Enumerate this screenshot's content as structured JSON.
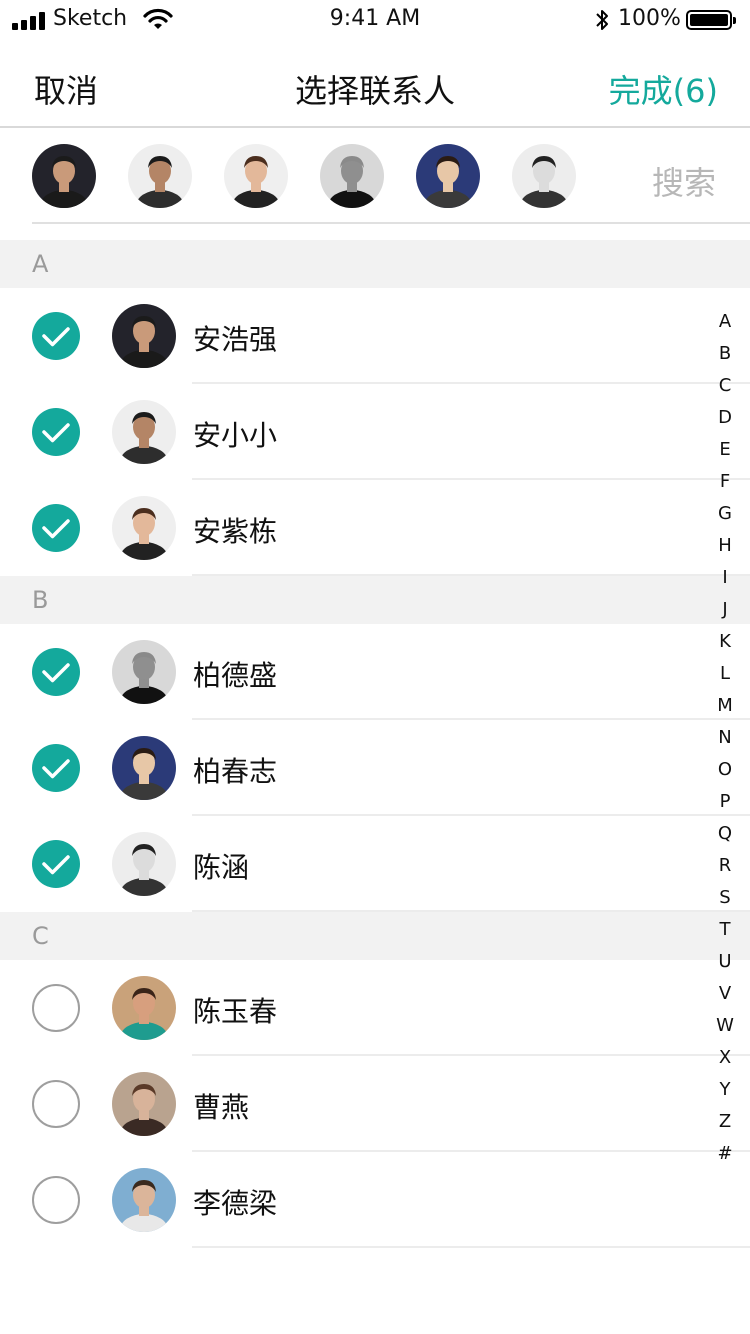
{
  "status_bar": {
    "carrier": "Sketch",
    "time": "9:41 AM",
    "battery": "100%"
  },
  "nav": {
    "cancel": "取消",
    "title": "选择联系人",
    "done": "完成(6)",
    "accent_color": "#14a99c"
  },
  "selected": {
    "avatars": [
      {
        "name": "安浩强",
        "icon": "avatar-man-beard",
        "bg": "#23232b",
        "skin": "#c99a7a",
        "hair": "#1b1b1b",
        "shirt": "#1a1a1a"
      },
      {
        "name": "安小小",
        "icon": "avatar-man-smile",
        "bg": "#eeeeee",
        "skin": "#b48566",
        "hair": "#1b1b1b",
        "shirt": "#2d2d2d"
      },
      {
        "name": "安紫栋",
        "icon": "avatar-woman-long-hair",
        "bg": "#efefef",
        "skin": "#e3b89a",
        "hair": "#4b2e1e",
        "shirt": "#222222"
      },
      {
        "name": "柏德盛",
        "icon": "avatar-man-bald",
        "bg": "#d8d8d8",
        "skin": "#8f8f8f",
        "hair": "#8a8a8a",
        "shirt": "#111111"
      },
      {
        "name": "柏春志",
        "icon": "avatar-woman-curly",
        "bg": "#2b3a78",
        "skin": "#e7c7a7",
        "hair": "#2a1b14",
        "shirt": "#3a3a3a"
      },
      {
        "name": "陈涵",
        "icon": "avatar-woman-glasses",
        "bg": "#ededed",
        "skin": "#dcdcdc",
        "hair": "#222222",
        "shirt": "#333333"
      }
    ],
    "search_label": "搜索"
  },
  "sections": [
    {
      "letter": "A",
      "contacts": [
        {
          "name": "安浩强",
          "checked": true,
          "icon": "avatar-man-beard",
          "bg": "#23232b",
          "skin": "#c99a7a",
          "hair": "#1b1b1b",
          "shirt": "#1a1a1a"
        },
        {
          "name": "安小小",
          "checked": true,
          "icon": "avatar-man-smile",
          "bg": "#eeeeee",
          "skin": "#b48566",
          "hair": "#1b1b1b",
          "shirt": "#2d2d2d"
        },
        {
          "name": "安紫栋",
          "checked": true,
          "icon": "avatar-woman-long-hair",
          "bg": "#efefef",
          "skin": "#e3b89a",
          "hair": "#4b2e1e",
          "shirt": "#222222"
        }
      ]
    },
    {
      "letter": "B",
      "contacts": [
        {
          "name": "柏德盛",
          "checked": true,
          "icon": "avatar-man-bald",
          "bg": "#d8d8d8",
          "skin": "#8f8f8f",
          "hair": "#8a8a8a",
          "shirt": "#111111"
        },
        {
          "name": "柏春志",
          "checked": true,
          "icon": "avatar-woman-curly",
          "bg": "#2b3a78",
          "skin": "#e7c7a7",
          "hair": "#2a1b14",
          "shirt": "#3a3a3a"
        },
        {
          "name": "陈涵",
          "checked": true,
          "icon": "avatar-woman-glasses",
          "bg": "#ededed",
          "skin": "#dcdcdc",
          "hair": "#222222",
          "shirt": "#333333"
        }
      ]
    },
    {
      "letter": "C",
      "contacts": [
        {
          "name": "陈玉春",
          "checked": false,
          "icon": "avatar-woman-dark-hair",
          "bg": "#c9a27a",
          "skin": "#d79f7e",
          "hair": "#3a2418",
          "shirt": "#1f9c8f"
        },
        {
          "name": "曹燕",
          "checked": false,
          "icon": "avatar-woman-brown",
          "bg": "#b9a38f",
          "skin": "#d8b39a",
          "hair": "#5a3a28",
          "shirt": "#3a2a24"
        },
        {
          "name": "李德梁",
          "checked": false,
          "icon": "avatar-man-styled-hair",
          "bg": "#7faed1",
          "skin": "#dbb59a",
          "hair": "#3a2a1e",
          "shirt": "#e8e8e8"
        }
      ]
    }
  ],
  "alphabet": [
    "A",
    "B",
    "C",
    "D",
    "E",
    "F",
    "G",
    "H",
    "I",
    "J",
    "K",
    "L",
    "M",
    "N",
    "O",
    "P",
    "Q",
    "R",
    "S",
    "T",
    "U",
    "V",
    "W",
    "X",
    "Y",
    "Z",
    "#"
  ]
}
